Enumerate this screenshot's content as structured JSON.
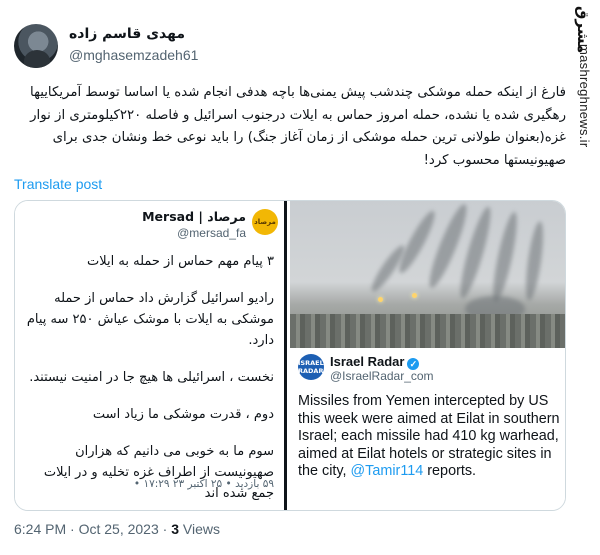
{
  "watermark": {
    "brand": "مشرق",
    "url": "mashreghnews.ir"
  },
  "author": {
    "display_name": "مهدی قاسم زاده",
    "handle": "@mghasemzadeh61"
  },
  "tweet": {
    "text": "فارغ از اینکه حمله موشکی چندشب پیش یمنی‌ها باچه هدفی انجام شده یا اساسا توسط آمریکاییها رهگیری شده یا نشده، حمله امروز حماس به ایلات درجنوب اسرائیل و فاصله ۲۲۰کیلومتری از نوار غزه(بعنوان طولانی ترین حمله موشکی از زمان آغاز جنگ) را باید نوعی خط ونشان جدی برای صهیونیستها محسوب کرد!",
    "translate_label": "Translate post"
  },
  "media": {
    "mersad": {
      "logo_text": "مرصاد",
      "name": "Mersad | مرصاد",
      "handle": "@mersad_fa",
      "lines": [
        "۳ پیام مهم حماس از حمله به ایلات",
        "رادیو اسرائیل گزارش داد حماس از حمله موشکی به ایلات با موشک عیاش ۲۵۰ سه پیام دارد.",
        "نخست ، اسرائیلی ها هیچ جا در امنیت نیستند.",
        "دوم ، قدرت موشکی ما زیاد است",
        "سوم ما به خوبی می دانیم که هزاران صهیونیست از اطراف غزه تخلیه و در ایلات جمع شده اند"
      ],
      "footer": "۵۹ بازدید • ۲۵ اکتبر ۲۳ ۱۷:۲۹ •"
    },
    "radar": {
      "logo_text": "ISRAEL RADAR",
      "name": "Israel Radar",
      "verified_icon": "check-verified-icon",
      "handle": "@IsraelRadar_com",
      "text": "Missiles from Yemen intercepted by US this week were aimed at Eilat in southern Israel; each missile had 410 kg warhead, aimed at Eilat hotels or strategic sites in the city,",
      "mention": "@Tamir114",
      "text_end": "reports."
    }
  },
  "meta": {
    "time": "6:24 PM",
    "date": "Oct 25, 2023",
    "views_count": "3",
    "views_label": "Views"
  }
}
